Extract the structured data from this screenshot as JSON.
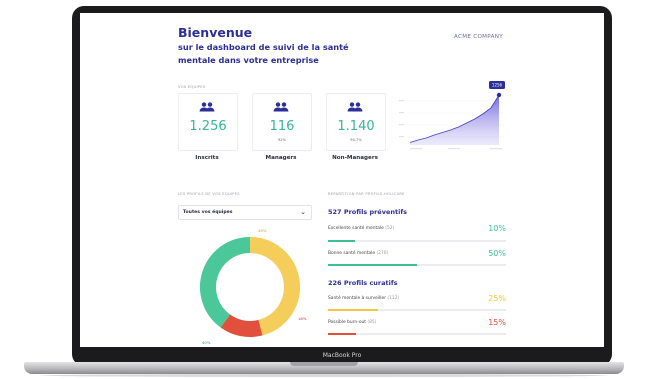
{
  "device": {
    "label": "MacBook Pro"
  },
  "header": {
    "title": "Bienvenue",
    "subtitle": "sur le dashboard de suivi de la santé mentale dans votre entreprise",
    "company": "ACME COMPANY"
  },
  "teams": {
    "section_label": "VOS ÉQUIPES",
    "cards": [
      {
        "value": "1.256",
        "percent": "",
        "caption": "Inscrits",
        "icon": "users-icon"
      },
      {
        "value": "116",
        "percent": "92%",
        "caption": "Managers",
        "icon": "users-icon"
      },
      {
        "value": "1.140",
        "percent": "90.7%",
        "caption": "Non-Managers",
        "icon": "users-icon"
      }
    ]
  },
  "trend": {
    "tooltip": "1256",
    "color": "#5b4fd6",
    "points": [
      0.05,
      0.1,
      0.14,
      0.2,
      0.25,
      0.3,
      0.36,
      0.44,
      0.52,
      0.62,
      0.74,
      1.0
    ]
  },
  "profiles": {
    "section_label": "LES PROFILS DE VOS ÉQUIPES",
    "filter_value": "Toutes vos équipes",
    "donut": {
      "segments": [
        {
          "value": 0.46,
          "color": "#f5cd5a",
          "label": "46%"
        },
        {
          "value": 0.14,
          "color": "#e0503c",
          "label": "18%"
        },
        {
          "value": 0.4,
          "color": "#4cc79a",
          "label": "40%"
        }
      ]
    }
  },
  "distribution": {
    "section_label": "RÉPARTITION PAR PROFILS-HOLICARE",
    "groups": [
      {
        "title": "527 Profils préventifs",
        "rows": [
          {
            "label": "Excellente santé mentale",
            "count": "(52)",
            "value": "10%",
            "fill": 0.15,
            "color": "#3fbf8f"
          },
          {
            "label": "Bonne santé mentale",
            "count": "(270)",
            "value": "50%",
            "fill": 0.5,
            "color": "#3fbf8f"
          }
        ]
      },
      {
        "title": "226 Profils curatifs",
        "rows": [
          {
            "label": "Santé mentale à surveiller",
            "count": "(112)",
            "value": "25%",
            "fill": 0.28,
            "color": "#f3c443"
          },
          {
            "label": "Possible burn-out",
            "count": "(85)",
            "value": "15%",
            "fill": 0.16,
            "color": "#e0503c"
          }
        ]
      }
    ]
  }
}
